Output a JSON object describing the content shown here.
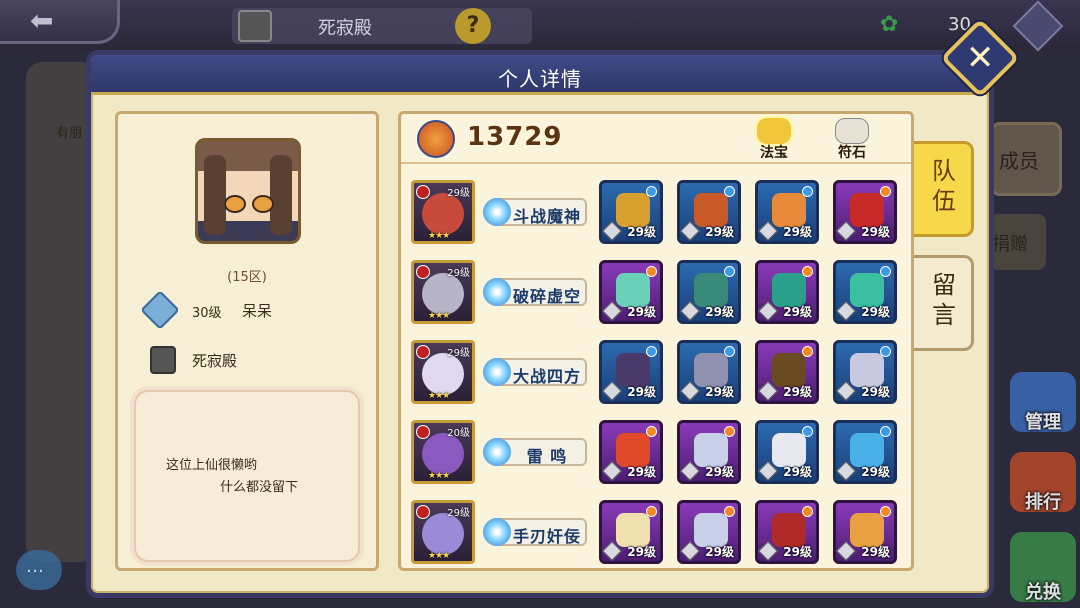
{
  "background": {
    "title": "死寂殿",
    "help_symbol": "?",
    "currency_value": "30",
    "left_panel_label": "有朋",
    "right_button_label": "成员",
    "right_button2_label": "捐赠",
    "side_buttons": [
      "管理",
      "排行",
      "兑换"
    ]
  },
  "modal": {
    "title": "个人详情",
    "close_symbol": "✕"
  },
  "profile": {
    "zone": "(15区)",
    "level": "30级",
    "name": "呆呆",
    "guild": "死寂殿",
    "message_line1": "这位上仙很懒哟",
    "message_line2": "什么都没留下"
  },
  "team": {
    "power": "13729",
    "tabs": [
      {
        "label": "法宝",
        "active": true
      },
      {
        "label": "符石",
        "active": false
      }
    ],
    "heroes": [
      {
        "level": "29级",
        "stars": "★★★",
        "skill": "斗战魔神",
        "portrait_color": "#c84a3a",
        "items": [
          {
            "rarity": "blue",
            "level": "29级",
            "color": "#d8a030"
          },
          {
            "rarity": "blue",
            "level": "29级",
            "color": "#c85a2a"
          },
          {
            "rarity": "blue",
            "level": "29级",
            "color": "#e88a3a"
          },
          {
            "rarity": "purple",
            "level": "29级",
            "color": "#c82a2a"
          }
        ]
      },
      {
        "level": "29级",
        "stars": "★★★",
        "skill": "破碎虚空",
        "portrait_color": "#b8b4c8",
        "items": [
          {
            "rarity": "purple",
            "level": "29级",
            "color": "#6ad0b8"
          },
          {
            "rarity": "blue",
            "level": "29级",
            "color": "#3a8a7a"
          },
          {
            "rarity": "purple",
            "level": "29级",
            "color": "#2aa08a"
          },
          {
            "rarity": "blue",
            "level": "29级",
            "color": "#3ac0a0"
          }
        ]
      },
      {
        "level": "29级",
        "stars": "★★★",
        "skill": "大战四方",
        "portrait_color": "#e0d8f0",
        "items": [
          {
            "rarity": "blue",
            "level": "29级",
            "color": "#4a3a6a"
          },
          {
            "rarity": "blue",
            "level": "29级",
            "color": "#9090b0"
          },
          {
            "rarity": "purple",
            "level": "29级",
            "color": "#6a4a20"
          },
          {
            "rarity": "blue",
            "level": "29级",
            "color": "#c8c8e0"
          }
        ]
      },
      {
        "level": "20级",
        "stars": "★★★",
        "skill": "雷 鸣",
        "portrait_color": "#8a5ac0",
        "items": [
          {
            "rarity": "purple",
            "level": "29级",
            "color": "#e04a2a"
          },
          {
            "rarity": "purple",
            "level": "29级",
            "color": "#c8d0e8"
          },
          {
            "rarity": "blue",
            "level": "29级",
            "color": "#e8e8f0"
          },
          {
            "rarity": "blue",
            "level": "29级",
            "color": "#4ab0e8"
          }
        ]
      },
      {
        "level": "29级",
        "stars": "★★★",
        "skill": "手刃奸佞",
        "portrait_color": "#9a8ad8",
        "items": [
          {
            "rarity": "purple",
            "level": "29级",
            "color": "#f0e0b0"
          },
          {
            "rarity": "purple",
            "level": "29级",
            "color": "#c8d0e8"
          },
          {
            "rarity": "purple",
            "level": "29级",
            "color": "#b02a2a"
          },
          {
            "rarity": "purple",
            "level": "29级",
            "color": "#e8a040"
          }
        ]
      }
    ]
  },
  "side_tabs": [
    {
      "label": "队伍",
      "active": true
    },
    {
      "label": "留言",
      "active": false
    }
  ],
  "colors": {
    "header": "#2f386c",
    "panel": "#f1e9c6",
    "active_tab": "#f7d84a"
  }
}
